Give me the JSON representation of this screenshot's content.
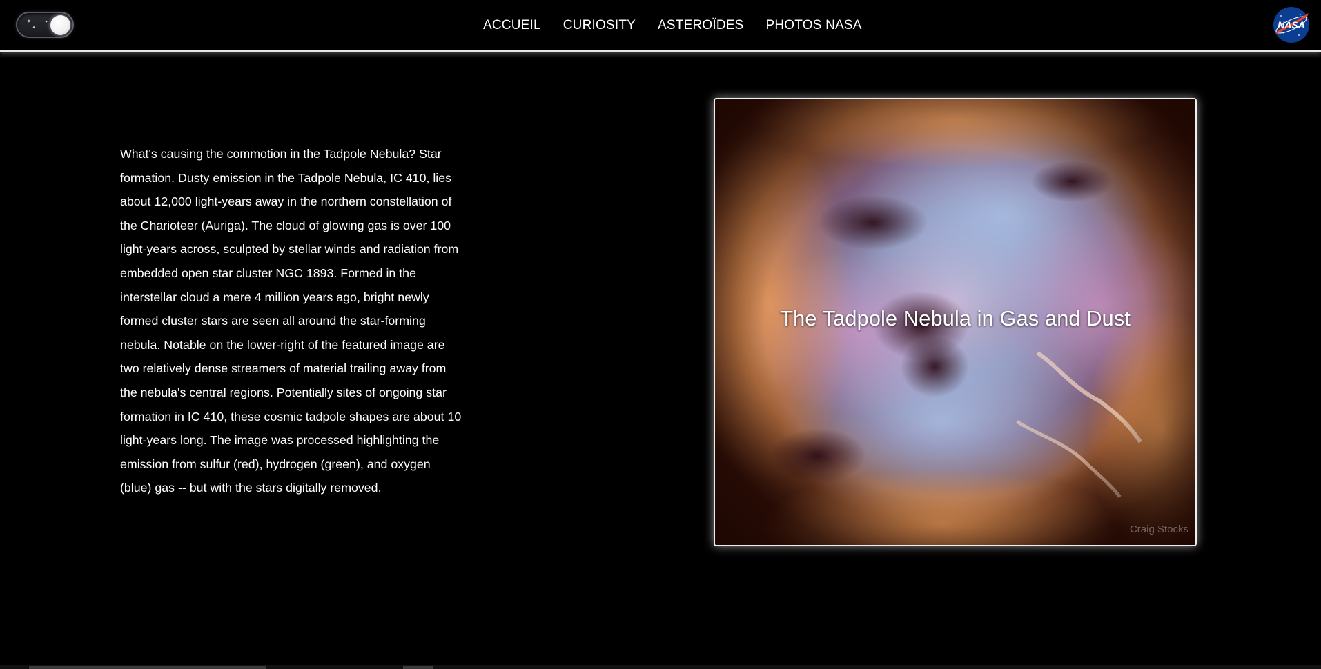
{
  "header": {
    "theme_toggle": {
      "state": "dark",
      "icon": "moon-toggle"
    },
    "nav": [
      {
        "label": "ACCUEIL"
      },
      {
        "label": "CURIOSITY"
      },
      {
        "label": "ASTEROÏDES"
      },
      {
        "label": "PHOTOS NASA"
      }
    ],
    "logo": {
      "icon": "nasa-meatball-logo",
      "text": "NASA"
    }
  },
  "apod": {
    "explanation": "What's causing the commotion in the Tadpole Nebula? Star formation. Dusty emission in the Tadpole Nebula, IC 410, lies about 12,000 light-years away in the northern constellation of the Charioteer (Auriga). The cloud of glowing gas is over 100 light-years across, sculpted by stellar winds and radiation from embedded open star cluster NGC 1893. Formed in the interstellar cloud a mere 4 million years ago, bright newly formed cluster stars are seen all around the star-forming nebula. Notable on the lower-right of the featured image are two relatively dense streamers of material trailing away from the nebula's central regions. Potentially sites of ongoing star formation in IC 410, these cosmic tadpole shapes are about 10 light-years long. The image was processed highlighting the emission from sulfur (red), hydrogen (green), and oxygen (blue) gas -- but with the stars digitally removed.",
    "title": "The Tadpole Nebula in Gas and Dust",
    "credit": "Craig Stocks",
    "image": {
      "icon": "tadpole-nebula-photo"
    }
  },
  "colors": {
    "background": "#000000",
    "text": "#ffffff",
    "header_border": "#e9e9e9",
    "nasa_blue": "#0b3d91",
    "nasa_red": "#fc3d21"
  }
}
